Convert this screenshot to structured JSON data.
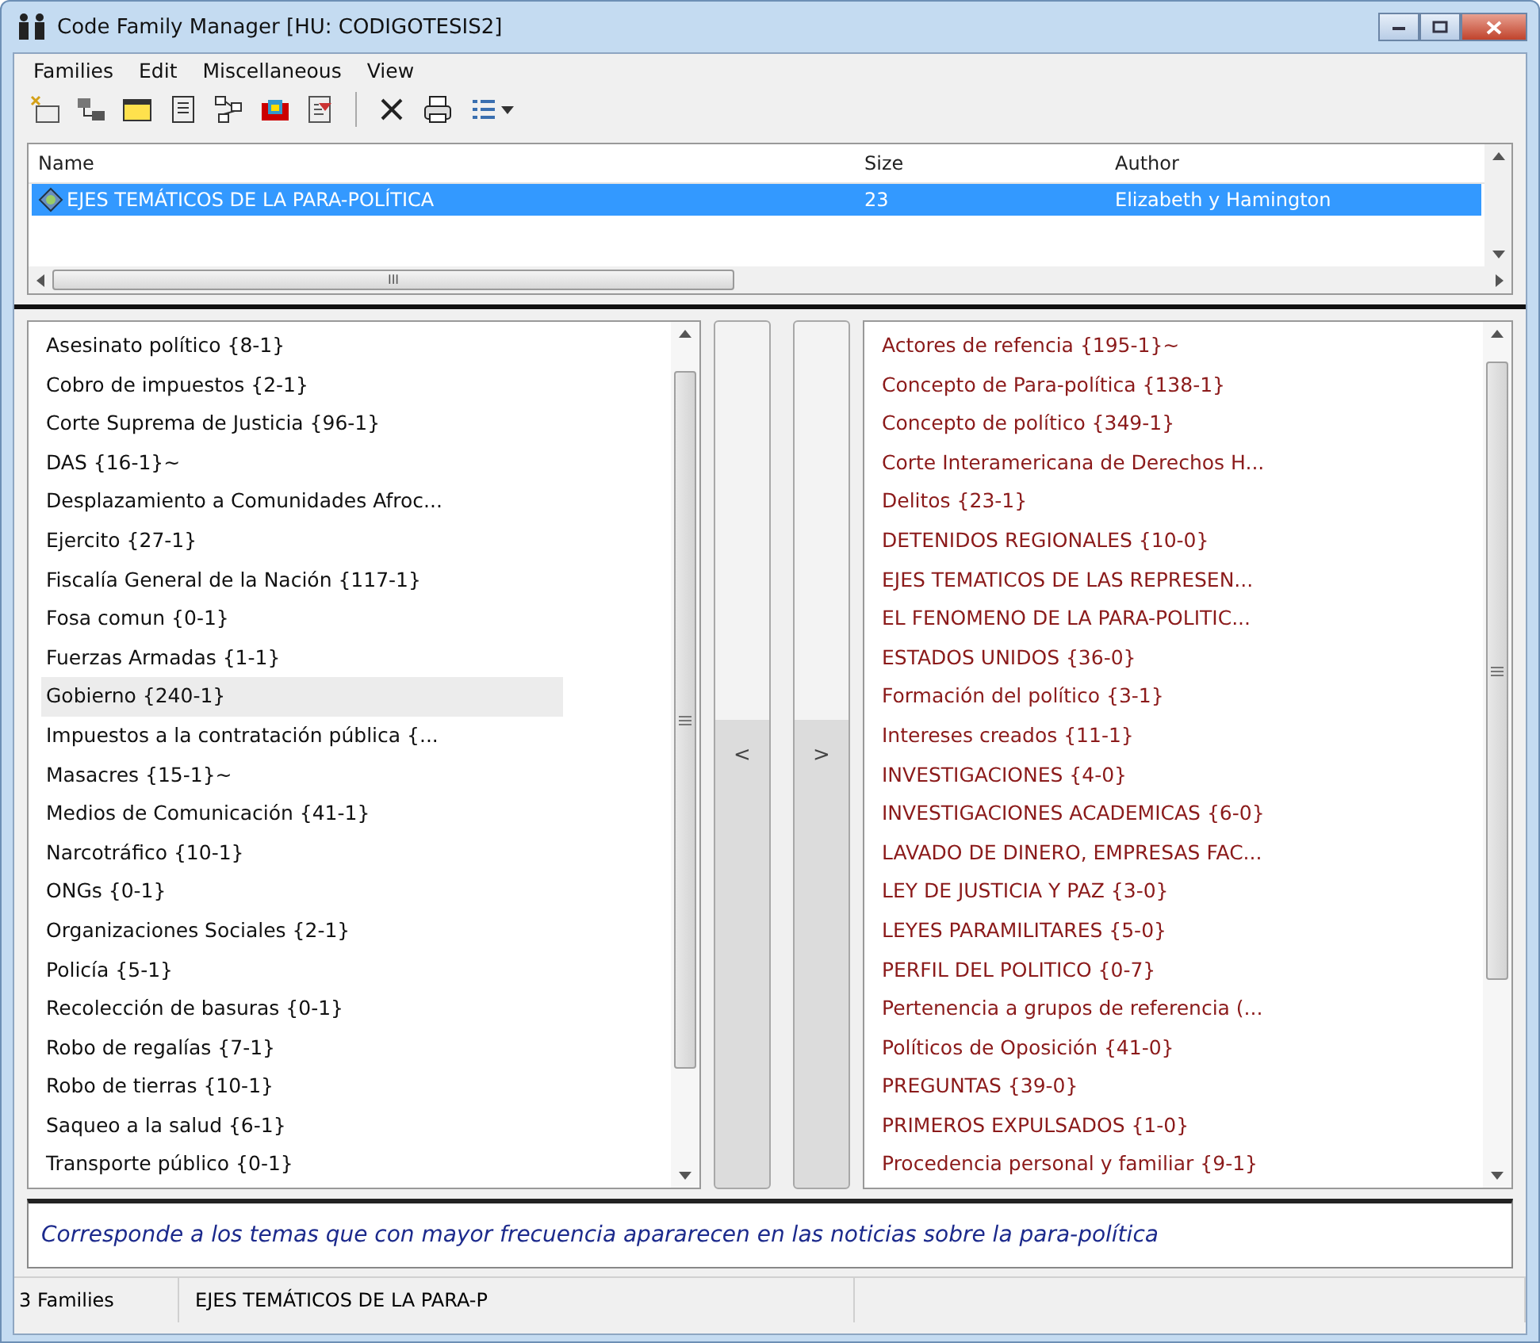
{
  "window": {
    "title": "Code Family Manager [HU: CODIGOTESIS2]"
  },
  "menu": [
    "Families",
    "Edit",
    "Miscellaneous",
    "View"
  ],
  "families_table": {
    "columns": [
      "Name",
      "Size",
      "Author"
    ],
    "rows": [
      {
        "name": "EJES TEMÁTICOS DE LA PARA-POLÍTICA",
        "size": "23",
        "author": "Elizabeth y Hamington",
        "selected": true
      }
    ]
  },
  "scroll_thumb_label": "III",
  "left_list": {
    "items": [
      {
        "label": "Asesinato político {8-1}",
        "selected": false
      },
      {
        "label": "Cobro de impuestos {2-1}",
        "selected": false
      },
      {
        "label": "Corte Suprema de Justicia {96-1}",
        "selected": false
      },
      {
        "label": "DAS {16-1}~",
        "selected": false
      },
      {
        "label": "Desplazamiento a Comunidades Afroc...",
        "selected": false
      },
      {
        "label": "Ejercito {27-1}",
        "selected": false
      },
      {
        "label": "Fiscalía General de la Nación {117-1}",
        "selected": false
      },
      {
        "label": "Fosa comun {0-1}",
        "selected": false
      },
      {
        "label": "Fuerzas Armadas {1-1}",
        "selected": false
      },
      {
        "label": "Gobierno {240-1}",
        "selected": true
      },
      {
        "label": "Impuestos a la contratación pública {...",
        "selected": false
      },
      {
        "label": "Masacres {15-1}~",
        "selected": false
      },
      {
        "label": "Medios de Comunicación {41-1}",
        "selected": false
      },
      {
        "label": "Narcotráfico {10-1}",
        "selected": false
      },
      {
        "label": "ONGs {0-1}",
        "selected": false
      },
      {
        "label": "Organizaciones Sociales {2-1}",
        "selected": false
      },
      {
        "label": "Policía {5-1}",
        "selected": false
      },
      {
        "label": "Recolección de basuras {0-1}",
        "selected": false
      },
      {
        "label": "Robo de regalías {7-1}",
        "selected": false
      },
      {
        "label": "Robo de tierras {10-1}",
        "selected": false
      },
      {
        "label": "Saqueo a la salud {6-1}",
        "selected": false
      },
      {
        "label": "Transporte público {0-1}",
        "selected": false
      }
    ]
  },
  "move_buttons": [
    "<",
    ">"
  ],
  "right_list": {
    "items": [
      "Actores de refencia {195-1}~",
      "Concepto de Para-política {138-1}",
      "Concepto de político {349-1}",
      "Corte Interamericana de Derechos H...",
      "Delitos {23-1}",
      "DETENIDOS REGIONALES {10-0}",
      "EJES TEMATICOS DE LAS REPRESEN...",
      "EL FENOMENO DE LA PARA-POLITIC...",
      "ESTADOS UNIDOS {36-0}",
      "Formación del político {3-1}",
      "Intereses creados {11-1}",
      "INVESTIGACIONES {4-0}",
      "INVESTIGACIONES ACADEMICAS {6-0}",
      "LAVADO DE DINERO, EMPRESAS FAC...",
      "LEY DE JUSTICIA Y PAZ {3-0}",
      "LEYES PARAMILITARES {5-0}",
      "PERFIL DEL POLITICO {0-7}",
      "Pertenencia a grupos de referencia (...",
      "Políticos de Oposición {41-0}",
      "PREGUNTAS {39-0}",
      "PRIMEROS EXPULSADOS {1-0}",
      "Procedencia personal y familiar {9-1}"
    ]
  },
  "comment": "Corresponde a los temas que con mayor frecuencia apararecen en las noticias sobre la para-política",
  "status_bar": [
    "3 Families",
    "EJES TEMÁTICOS DE LA PARA-P"
  ]
}
